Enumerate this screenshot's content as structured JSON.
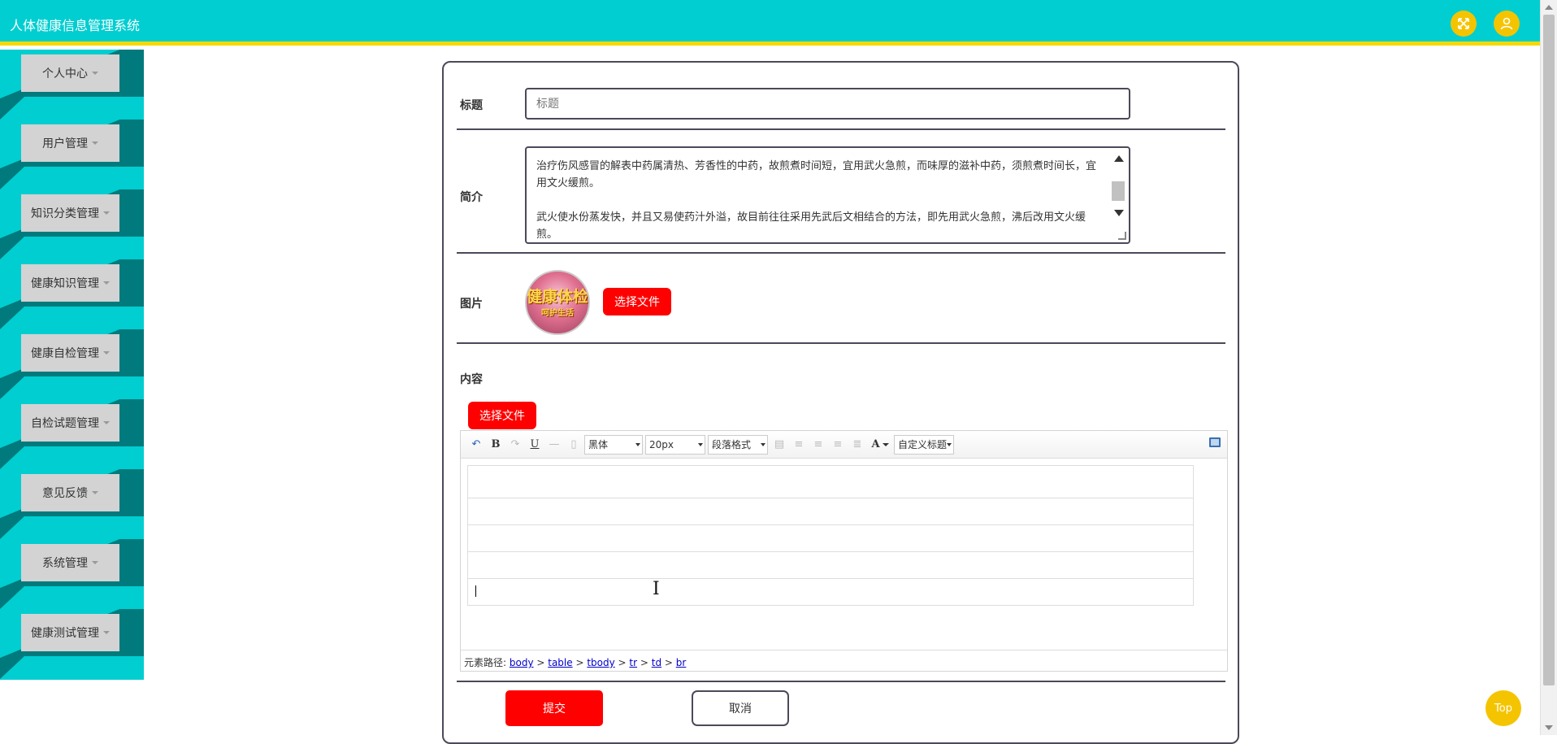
{
  "app": {
    "title": "人体健康信息管理系统"
  },
  "header": {
    "icons": [
      "fullscreen-icon",
      "user-icon"
    ]
  },
  "colors": {
    "primary": "#00CED1",
    "accent": "#F5C400",
    "danger": "#FF0000",
    "sidebar_dark": "#007A7C"
  },
  "sidebar": {
    "items": [
      {
        "label": "个人中心"
      },
      {
        "label": "用户管理"
      },
      {
        "label": "知识分类管理"
      },
      {
        "label": "健康知识管理"
      },
      {
        "label": "健康自检管理"
      },
      {
        "label": "自检试题管理"
      },
      {
        "label": "意见反馈"
      },
      {
        "label": "系统管理"
      },
      {
        "label": "健康测试管理"
      }
    ]
  },
  "form": {
    "title_label": "标题",
    "title_placeholder": "标题",
    "intro_label": "简介",
    "intro_text": [
      "治疗伤风感冒的解表中药属清热、芳香性的中药，故煎煮时间短，宜用武火急煎，而味厚的滋补中药，须煎煮时间长，宜用文火缓煎。",
      "武火使水份蒸发快，并且又易使药汁外溢，故目前往往采用先武后文相结合的方法，即先用武火急煎，沸后改用文火缓煎。"
    ],
    "image_label": "图片",
    "image_logo_line1": "健康体检",
    "image_logo_line2": "呵护生活",
    "choose_file_label": "选择文件",
    "content_label": "内容",
    "content_choose_file_label": "选择文件",
    "submit_label": "提交",
    "cancel_label": "取消"
  },
  "editor": {
    "font_family": "黑体",
    "font_size": "20px",
    "paragraph_format": "段落格式",
    "custom_title": "自定义标题",
    "font_color_label": "A",
    "bold_label": "B",
    "underline_label": "U",
    "path_label": "元素路径:",
    "path": [
      "body",
      "table",
      "tbody",
      "tr",
      "td",
      "br"
    ]
  },
  "back_to_top": "Top"
}
